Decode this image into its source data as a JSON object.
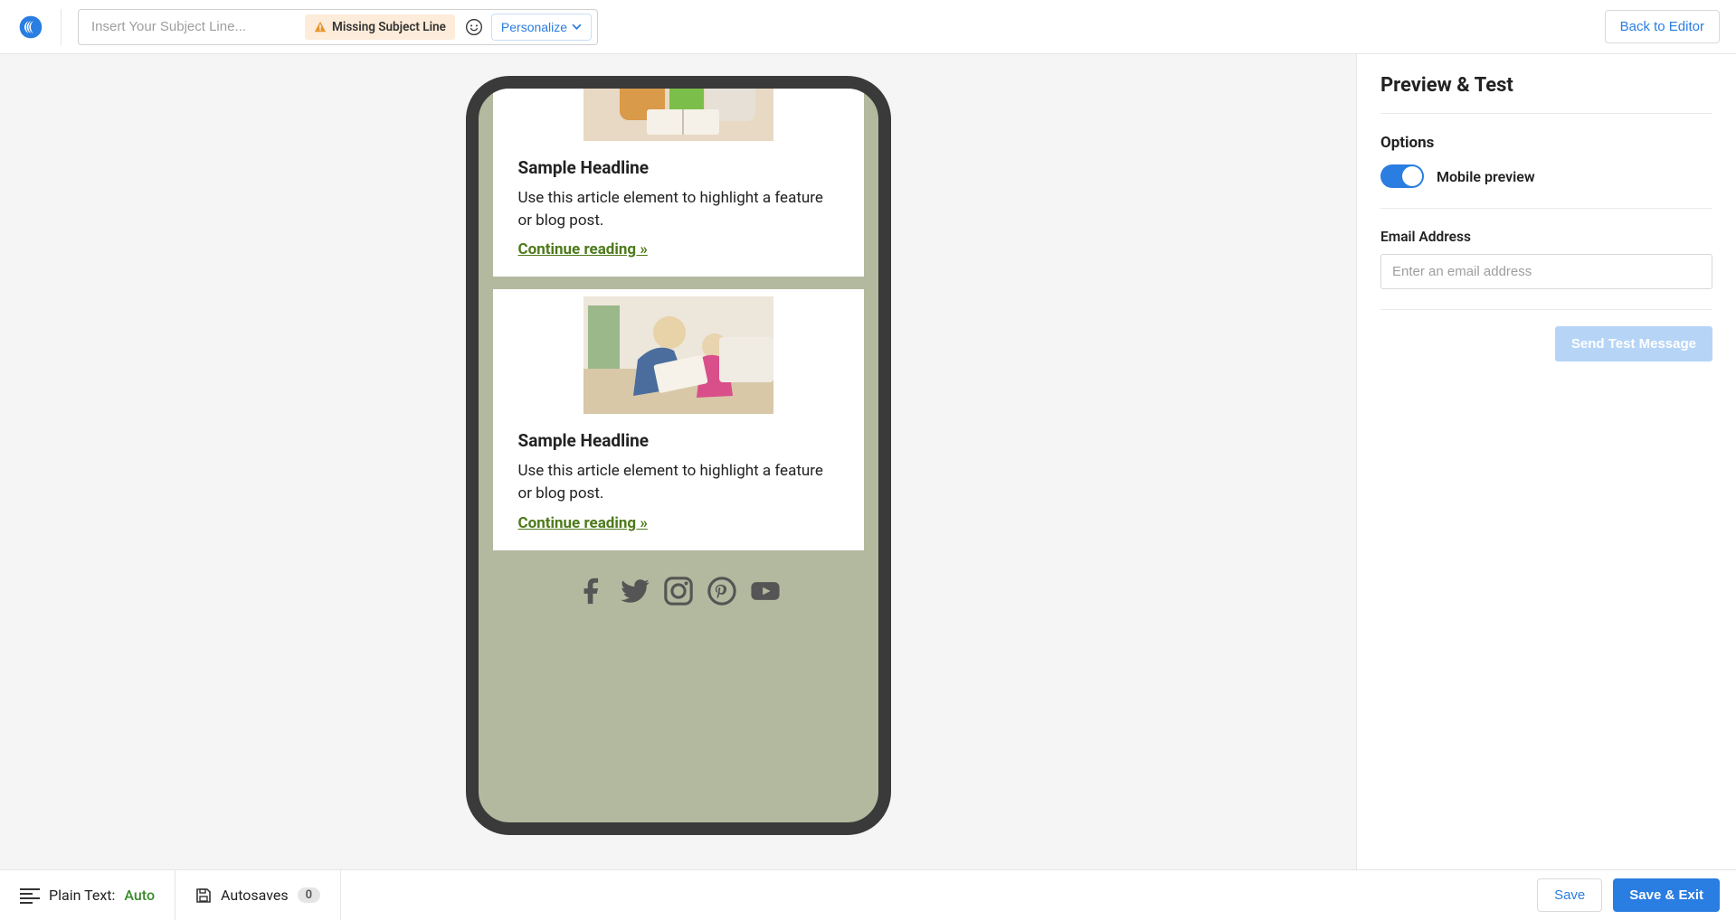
{
  "topbar": {
    "subject_placeholder": "Insert Your Subject Line...",
    "warning_label": "Missing Subject Line",
    "personalize_label": "Personalize",
    "back_label": "Back to Editor"
  },
  "preview": {
    "articles": [
      {
        "headline": "Sample Headline",
        "body": "Use this article element to highlight a feature or blog post.",
        "link": "Continue reading »"
      },
      {
        "headline": "Sample Headline",
        "body": "Use this article element to highlight a feature or blog post.",
        "link": "Continue reading »"
      }
    ]
  },
  "right": {
    "title": "Preview & Test",
    "options_label": "Options",
    "mobile_toggle_label": "Mobile preview",
    "mobile_toggle_on": true,
    "email_label": "Email Address",
    "email_placeholder": "Enter an email address",
    "send_test_label": "Send Test Message"
  },
  "bottombar": {
    "plain_text_label": "Plain Text:",
    "plain_text_value": "Auto",
    "autosaves_label": "Autosaves",
    "autosaves_count": "0",
    "save_label": "Save",
    "save_exit_label": "Save & Exit"
  }
}
